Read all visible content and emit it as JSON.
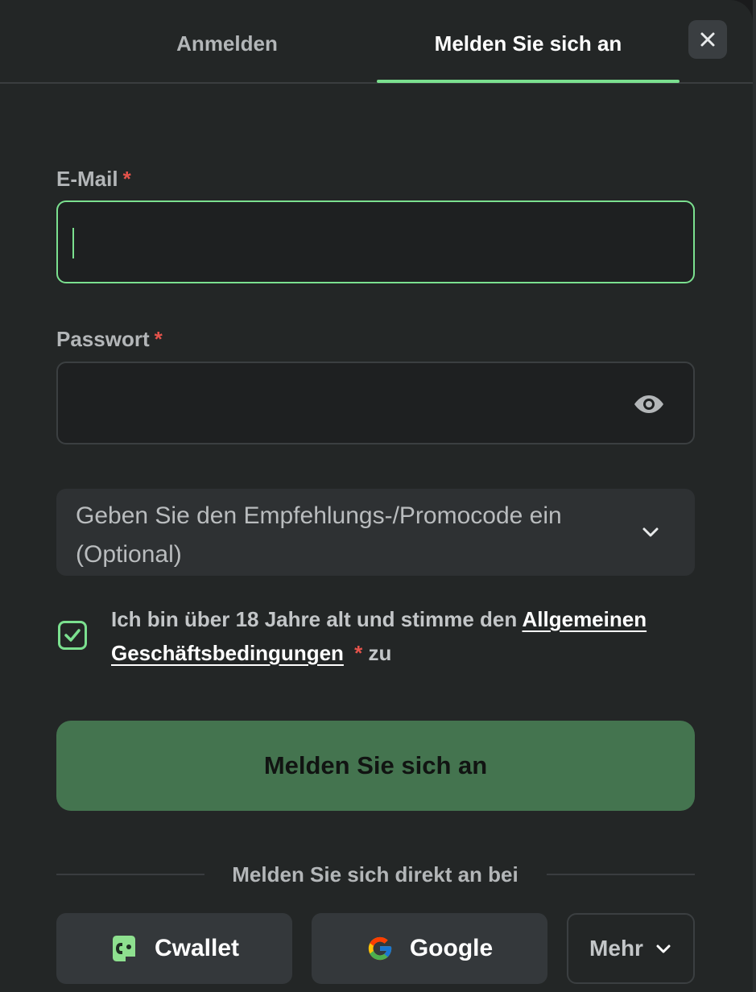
{
  "tabs": {
    "login_label": "Anmelden",
    "register_label": "Melden Sie sich an",
    "active": "register"
  },
  "form": {
    "email": {
      "label": "E-Mail",
      "required_mark": "*",
      "value": "",
      "focused": true
    },
    "password": {
      "label": "Passwort",
      "required_mark": "*",
      "value": ""
    },
    "promo": {
      "text": "Geben Sie den Empfehlungs-/Promocode ein (Optional)"
    },
    "terms": {
      "checked": true,
      "text_before": "Ich bin über 18 Jahre alt und stimme den ",
      "link_label": "Allgemeinen Geschäftsbedingungen",
      "required_mark": "*",
      "text_after": "zu"
    },
    "submit_label": "Melden Sie sich an"
  },
  "social": {
    "divider_text": "Melden Sie sich direkt an bei",
    "cwallet_label": "Cwallet",
    "google_label": "Google",
    "more_label": "Mehr"
  },
  "colors": {
    "accent": "#7be08f",
    "button": "#44744f",
    "background": "#232626",
    "required": "#e5534b"
  },
  "icons": [
    "close-icon",
    "eye-icon",
    "chevron-down-icon",
    "checkmark-icon",
    "cwallet-logo-icon",
    "google-logo-icon"
  ]
}
